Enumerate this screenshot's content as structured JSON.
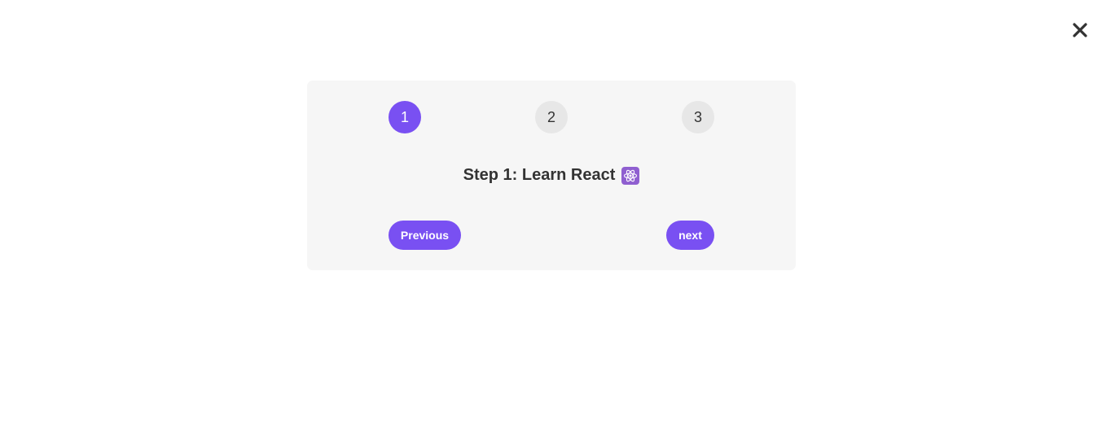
{
  "close_button": {
    "label": "×",
    "icon": "close-icon"
  },
  "steps": [
    {
      "label": "1",
      "active": true
    },
    {
      "label": "2",
      "active": false
    },
    {
      "label": "3",
      "active": false
    }
  ],
  "message": {
    "text": "Step 1: Learn React",
    "icon": "atom-icon"
  },
  "buttons": {
    "previous": "Previous",
    "next": "next"
  },
  "colors": {
    "accent": "#7950f2",
    "inactive_step": "#e7e7e7",
    "card_background": "#f6f6f6",
    "text": "#333333"
  }
}
